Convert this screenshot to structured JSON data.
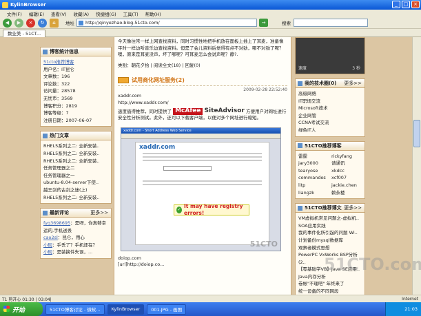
{
  "window": {
    "title": "KylinBrowser"
  },
  "menu": [
    "文件(F)",
    "编辑(E)",
    "查看(V)",
    "收藏(A)",
    "快捷组(G)",
    "工具(T)",
    "帮助(H)"
  ],
  "toolbar": {
    "address_label": "地址",
    "url": "http://qinyezhao.blog.51cto.com/",
    "search_label": "搜索"
  },
  "tab": {
    "label": "数业美 - 51CT..."
  },
  "left": {
    "stats_title": "博客统计信息",
    "blog_name": "51cto推荐博客",
    "stats": [
      "用户名：IT昆仑",
      "文章数：196",
      "评论数：322",
      "访问量：28578",
      "无忧币：3569",
      "博客积分：2819",
      "博客等级：7",
      "注册日期：2007-06-07"
    ],
    "hot_title": "热门文章",
    "hot_items": [
      "RHEL5系列之二: 全新安装..",
      "RHEL5系列之二: 全新安装..",
      "RHEL5系列之二: 全新安装..",
      "任务管理器之二",
      "任务管理器之一",
      "ubuntu-8.04-server下使..",
      "越王剑的古剑之迷(上)",
      "RHEL5系列之二: 全新安装.."
    ],
    "comments_title": "最新评论",
    "comments_more": "更多>>",
    "comments": [
      {
        "user": "fyq3698695",
        "text": "：是呀，你真够幸运的,手机送丢"
      },
      {
        "user": "cao2sl",
        "text": "：昆仑，用心"
      },
      {
        "user": "小砚",
        "text": "：手丢了？手机还在？"
      },
      {
        "user": "小砚",
        "text": "：是装换件失误，..."
      }
    ]
  },
  "post": {
    "intro": "今天像往常一样上网查找资料，同时习惯性地把手机放在面板上插上了耳麦，准备像平时一样边听音乐边查找资料。但是了会儿资料后觉得有点不对劲，哪不对劲了呢？噢，原来是耳麦没声，坏了哪呢？可耳麦怎么会说声呢？静?.",
    "meta": "类别：朝花夕拾 | 阅读全文(18) | 回复(0)",
    "title": "试用商化网址服务(2)",
    "date": "2009-02-28 22:52:40",
    "line1": "xaddr.com",
    "line2": "http://www.xaddr.com/",
    "desc_a": "速度值得推荐，同时提供了",
    "mcafee": "McAfee",
    "siteadvisor": "SiteAdvisor",
    "desc_b": "方便用户对网址进行安全性分析测试。此外，还可以下载客户端，以便对多个网址进行缩短。",
    "shot_title": "xaddr.com - Short Address Web Service",
    "shot_logo": "xaddr.com",
    "shot_warning": "It may have registry errors!",
    "shot_watermark": "51CTO",
    "line3": "doiop.com",
    "line4": "[url]http://doiop.co..."
  },
  "right": {
    "media_left": "速度",
    "media_right": "3 秒",
    "tech_title": "我的技术圈(0)",
    "tech_more": "更多>>",
    "tech_items": [
      "高级网络",
      "IT职场交流",
      "Microsoft技术",
      "企业网管",
      "CCNA考试交流",
      "绿色IT人"
    ],
    "bloggers_title": "51CTO推荐博客",
    "bloggers": [
      "雷霆",
      "rickyfang",
      "jary3000",
      "请通讯",
      "tearyose",
      "xkdcc",
      "commandos",
      "xcf007",
      "litp",
      "jackie.chen",
      "liangzk",
      "赖永楼"
    ],
    "articles_title": "51CTO推荐博文",
    "articles_more": "更多>>",
    "articles": [
      "VM虚拟机常见问题之-虚拟机..",
      "SOA应用实践",
      "我的事件化所引起的问题 Wi..",
      "计划备份mysql数据库",
      "观察者模式思想",
      "PowerPC VxWorks BSP分析(2..",
      "【零基础学VB】Java SE应用..",
      "Java内存分析",
      "卷帐\"不理吧\" 年终来了",
      "统一设备的不同网段"
    ]
  },
  "watermark": "51CTO.com",
  "status": {
    "left": "T1  剪开心 01:30 | 03:04|",
    "right": "Internet"
  },
  "taskbar": {
    "start": "开始",
    "tasks": [
      "51CTO博客讨论 - 微软...",
      "KylinBrowser",
      "001.JPG - 画图"
    ],
    "clock": "21:03"
  }
}
